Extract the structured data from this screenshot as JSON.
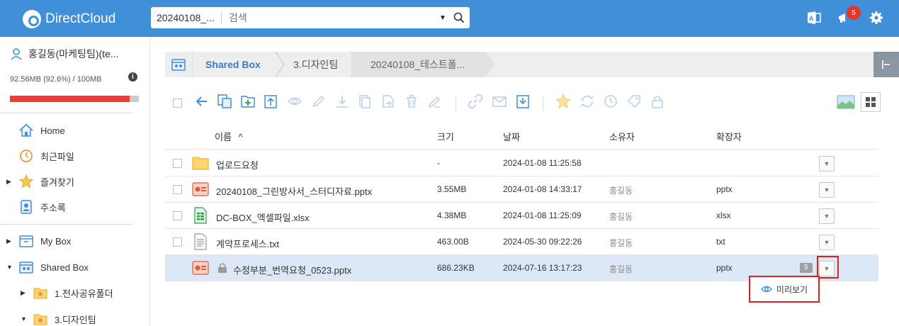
{
  "header": {
    "brand": "DirectCloud",
    "search_scope": "20240108_...",
    "search_placeholder": "검색",
    "notification_count": "5",
    "colors": {
      "topbar": "#3f8fd9",
      "badge": "#e8342b"
    }
  },
  "sidebar": {
    "user_name": "홍길동(마케팅팀)(te...",
    "quota_text": "92.56MB (92.6%) / 100MB",
    "quota_fraction": 0.926,
    "items": [
      {
        "label": "Home",
        "icon": "home-icon"
      },
      {
        "label": "최근파일",
        "icon": "clock-icon"
      },
      {
        "label": "즐겨찾기",
        "icon": "star-icon"
      },
      {
        "label": "주소록",
        "icon": "contacts-icon"
      },
      {
        "label": "My Box",
        "icon": "box-icon"
      },
      {
        "label": "Shared Box",
        "icon": "shared-box-icon"
      },
      {
        "label": "1.전사공유폴더",
        "icon": "shared-folder-icon"
      },
      {
        "label": "3.디자인팀",
        "icon": "shared-folder-icon"
      }
    ]
  },
  "breadcrumb": {
    "items": [
      "Shared Box",
      "3.디자인팀",
      "20240108_테스트폴..."
    ]
  },
  "table": {
    "columns": [
      "이름",
      "크기",
      "날짜",
      "소유자",
      "확장자"
    ],
    "sort_indicator": "^",
    "rows": [
      {
        "name": "업로드요청",
        "size": "-",
        "date": "2024-01-08 11:25:58",
        "owner": "",
        "ext": "",
        "type": "folder"
      },
      {
        "name": "20240108_그린방사서_스터디자료.pptx",
        "size": "3.55MB",
        "date": "2024-01-08 14:33:17",
        "owner": "홍길동",
        "ext": "pptx",
        "type": "pptx"
      },
      {
        "name": "DC-BOX_엑셀파일.xlsx",
        "size": "4.38MB",
        "date": "2024-01-08 11:25:09",
        "owner": "홍길동",
        "ext": "xlsx",
        "type": "xlsx"
      },
      {
        "name": "계약프로세스.txt",
        "size": "463.00B",
        "date": "2024-05-30 09:22:26",
        "owner": "홍길동",
        "ext": "txt",
        "type": "txt"
      },
      {
        "name": "수정부분_번역요청_0523.pptx",
        "size": "686.23KB",
        "date": "2024-07-16 13:17:23",
        "owner": "홍길동",
        "ext": "pptx",
        "type": "pptx",
        "version": "5",
        "locked": true,
        "selected": true
      }
    ]
  },
  "popup": {
    "label": "미리보기",
    "icon": "eye-icon"
  }
}
